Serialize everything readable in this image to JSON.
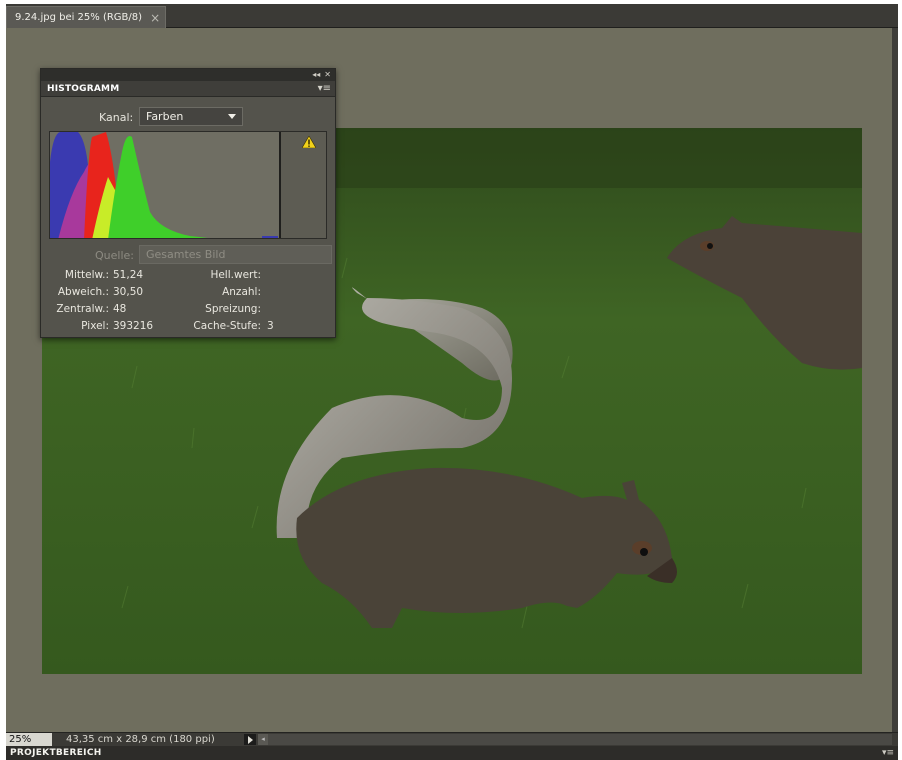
{
  "document_tab": {
    "label": "9.24.jpg bei 25% (RGB/8)",
    "close_glyph": "×"
  },
  "histogram_panel": {
    "title": "HISTOGRAMM",
    "collapse_glyph": "◂◂",
    "close_glyph": "✕",
    "menu_glyph": "▾≡",
    "channel_label": "Kanal:",
    "channel_value": "Farben",
    "warning_icon": "warning-triangle-icon",
    "source_label": "Quelle:",
    "source_value": "Gesamtes Bild",
    "stats": {
      "mean_label": "Mittelw.:",
      "mean_value": "51,24",
      "stddev_label": "Abweich.:",
      "stddev_value": "30,50",
      "median_label": "Zentralw.:",
      "median_value": "48",
      "pixels_label": "Pixel:",
      "pixels_value": "393216",
      "level_label": "Hell.wert:",
      "level_value": "",
      "count_label": "Anzahl:",
      "count_value": "",
      "percentile_label": "Spreizung:",
      "percentile_value": "",
      "cache_label": "Cache-Stufe:",
      "cache_value": "3"
    },
    "colors": {
      "blue": "#3a3ab0",
      "red": "#e8241c",
      "green": "#3fcf2a",
      "yellow": "#c8ec28",
      "magenta": "#b53a9a"
    }
  },
  "status_bar": {
    "zoom": "25%",
    "document_size": "43,35 cm x 28,9 cm (180 ppi)"
  },
  "project_bar": {
    "label": "PROJEKTBEREICH"
  }
}
